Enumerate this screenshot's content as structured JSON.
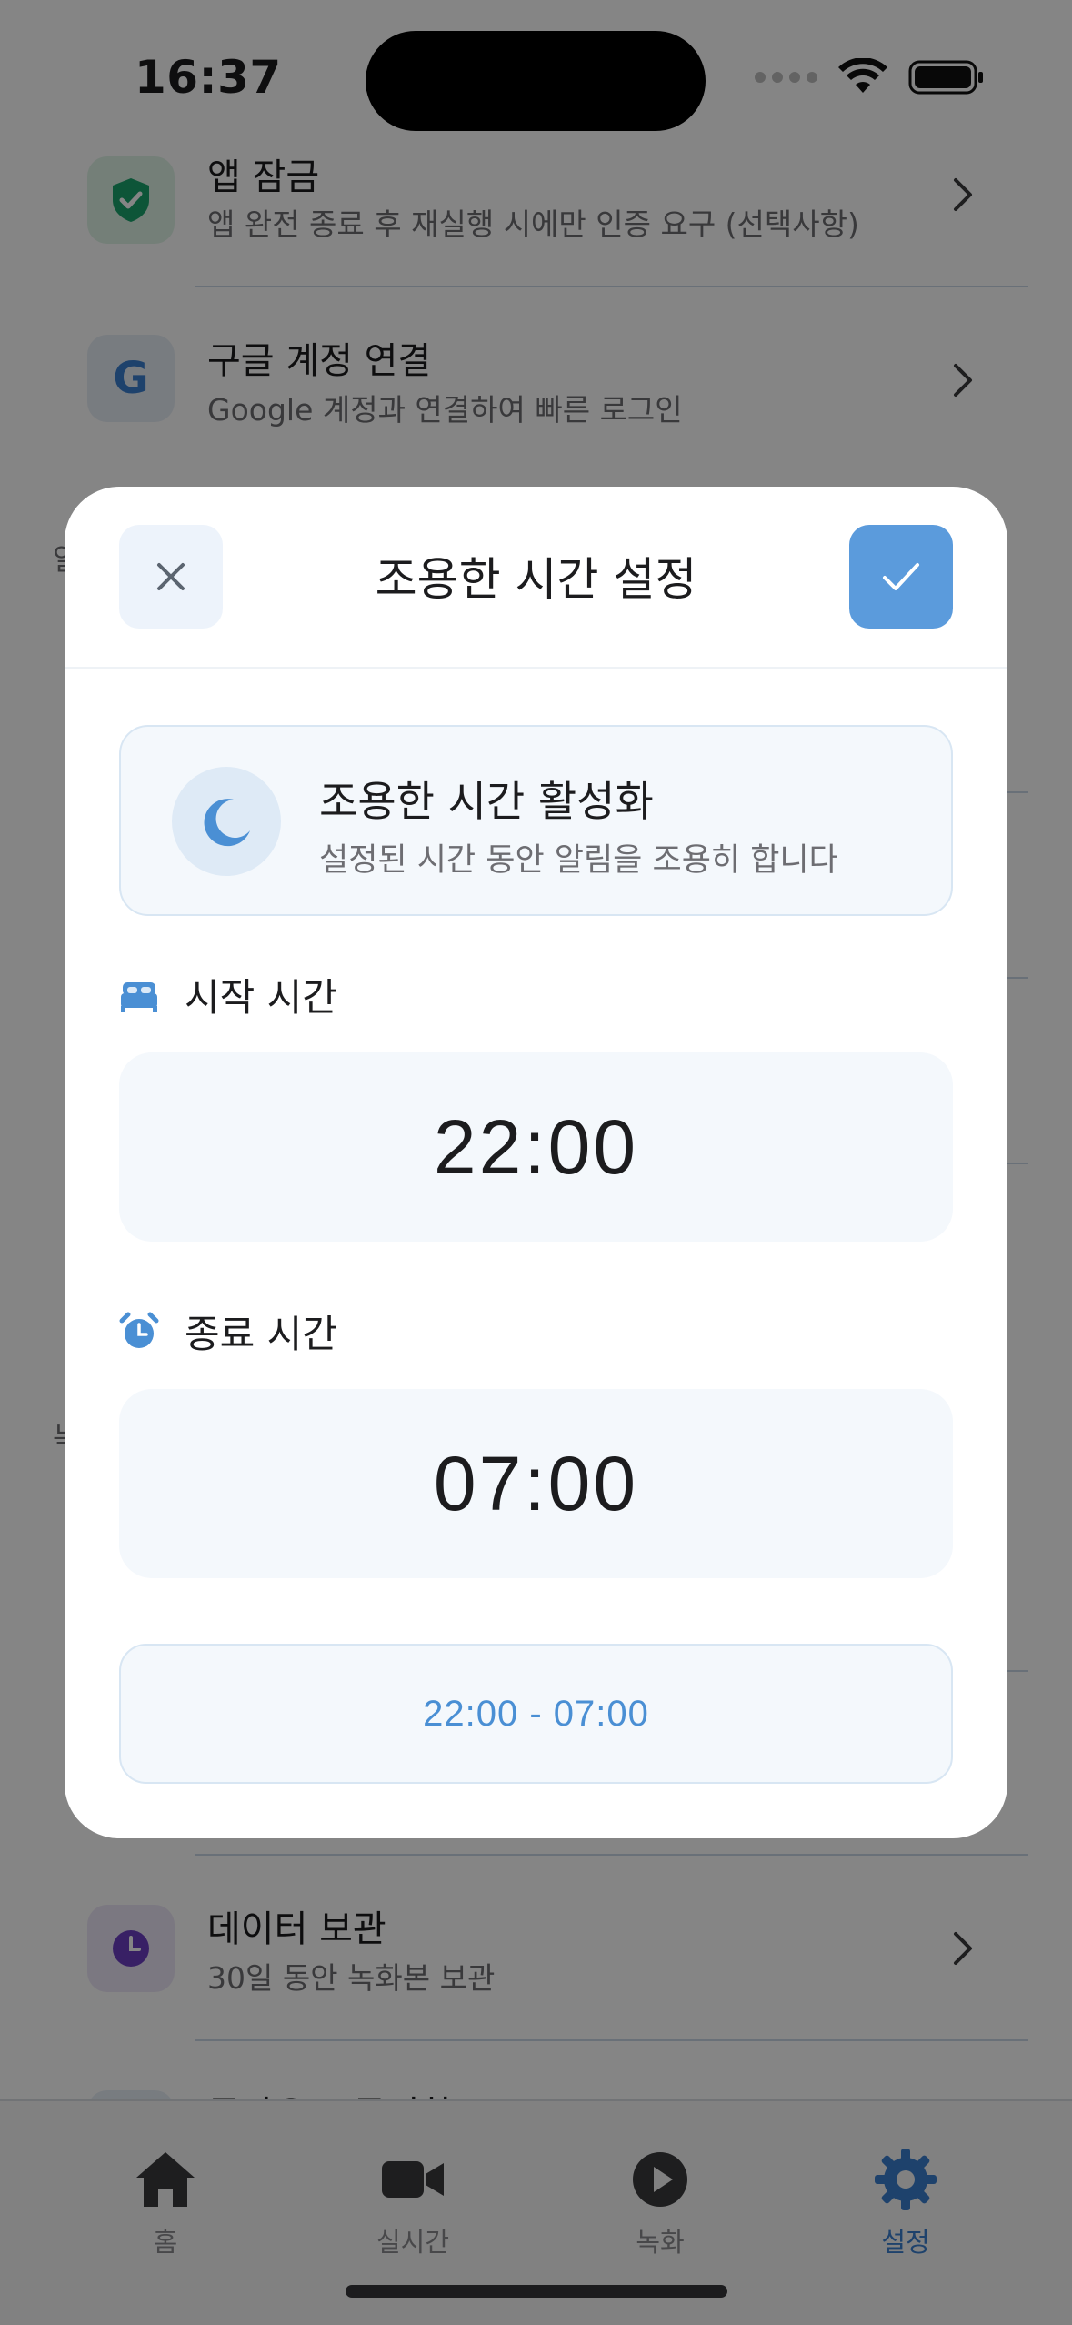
{
  "status_bar": {
    "time": "16:37"
  },
  "background_settings": {
    "rows": [
      {
        "title": "앱 잠금",
        "subtitle": "앱 완전 종료 후 재실행 시에만 인증 요구 (선택사항)",
        "icon": "shield-check-icon",
        "icon_bg": "#dff3e7",
        "icon_color": "#1aa36b"
      },
      {
        "title": "구글 계정 연결",
        "subtitle": "Google 계정과 연결하여 빠른 로그인",
        "icon": "google-g-icon",
        "icon_glyph": "G",
        "icon_bg": "#e7eef6",
        "icon_color": "#3b7fd0"
      },
      {
        "title": "데이터 보관",
        "subtitle": "30일 동안 녹화본 보관",
        "icon": "clock-icon",
        "icon_bg": "#ece6f7",
        "icon_color": "#6b3fc2"
      },
      {
        "title": "클라우드 동기화",
        "subtitle": "",
        "icon": "cloud-icon",
        "icon_bg": "#e7eef6",
        "icon_color": "#3b7fd0"
      }
    ],
    "partial_left_chars": [
      "알",
      "녹"
    ]
  },
  "tab_bar": {
    "tabs": [
      {
        "label": "홈",
        "icon": "home-icon",
        "active": false
      },
      {
        "label": "실시간",
        "icon": "video-camera-icon",
        "active": false
      },
      {
        "label": "녹화",
        "icon": "play-circle-icon",
        "active": false
      },
      {
        "label": "설정",
        "icon": "gear-icon",
        "active": true
      }
    ]
  },
  "modal": {
    "title": "조용한 시간 설정",
    "enable": {
      "title": "조용한 시간 활성화",
      "subtitle": "설정된 시간 동안 알림을 조용히 합니다"
    },
    "start": {
      "label": "시작 시간",
      "value": "22:00",
      "icon": "bed-icon"
    },
    "end": {
      "label": "종료 시간",
      "value": "07:00",
      "icon": "alarm-clock-icon"
    },
    "range_summary": "22:00 - 07:00"
  },
  "colors": {
    "accent": "#5b9bdc",
    "accent_text": "#4a8fd4",
    "card_bg": "#f4f8fc",
    "overlay": "rgba(0,0,0,0.48)"
  }
}
